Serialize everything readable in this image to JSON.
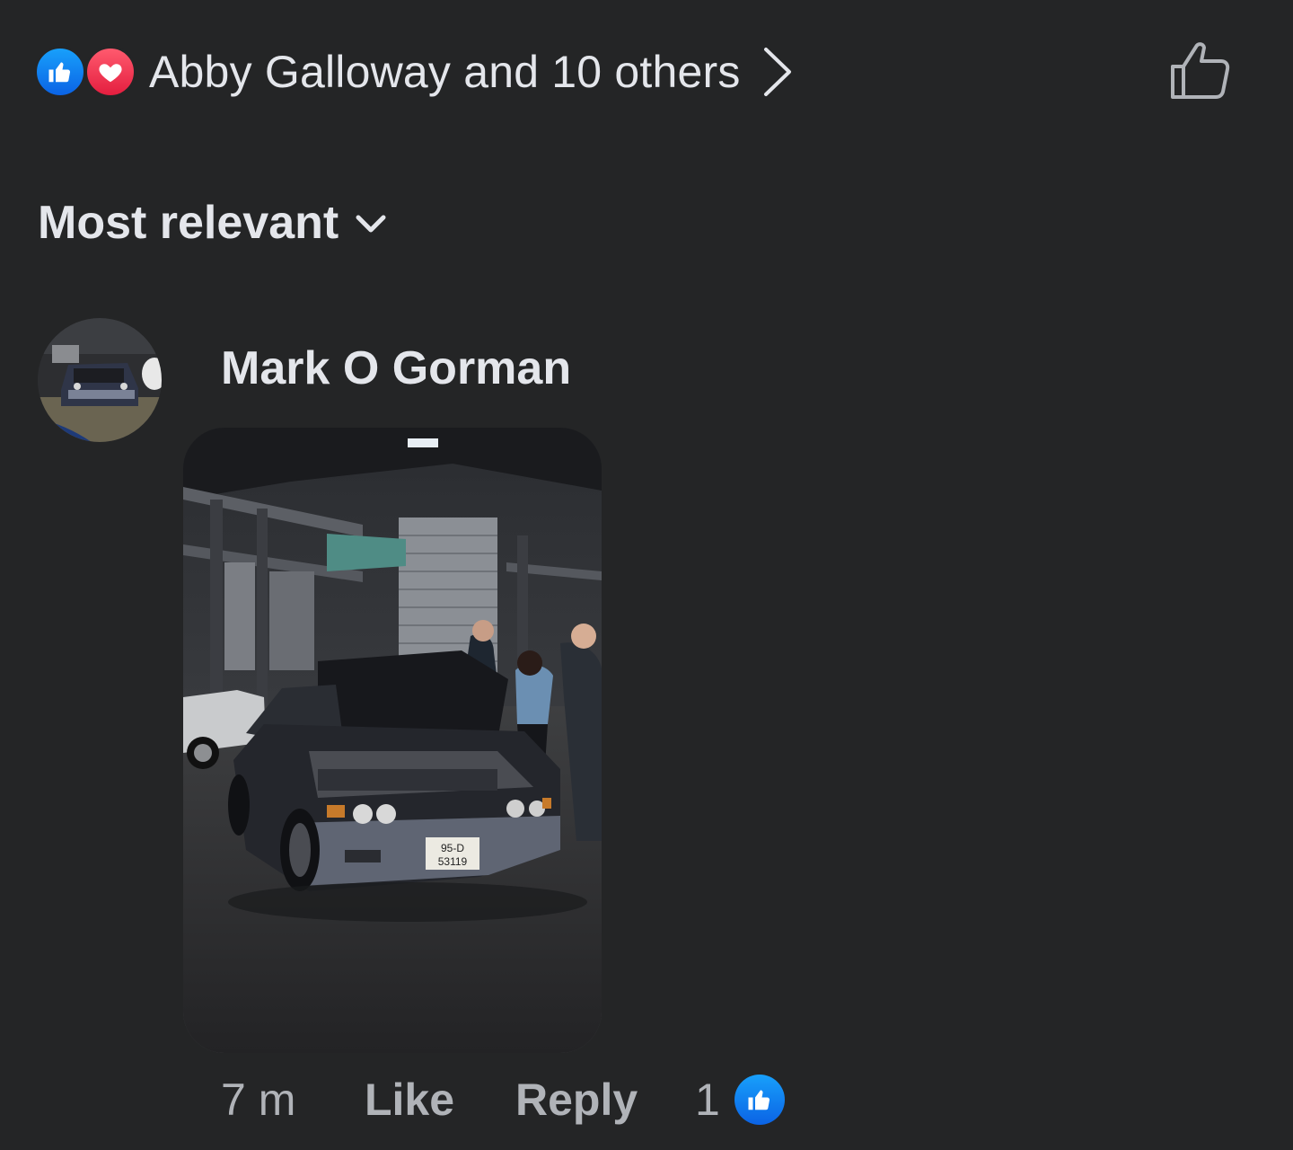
{
  "reactions": {
    "summary": "Abby Galloway and 10 others",
    "icons": [
      "like-reaction-icon",
      "love-reaction-icon"
    ],
    "colors": {
      "like": "#1877F2",
      "love": "#F33E58"
    }
  },
  "sort": {
    "label": "Most relevant"
  },
  "comment": {
    "author": "Mark O Gorman",
    "time": "7 m",
    "like_label": "Like",
    "reply_label": "Reply",
    "reaction_count": "1",
    "photo": {
      "plate_top": "95-D",
      "plate_bottom": "53119"
    }
  },
  "theme": {
    "background": "#242526",
    "text_primary": "#E4E6EB",
    "text_secondary": "#B0B3B8"
  }
}
